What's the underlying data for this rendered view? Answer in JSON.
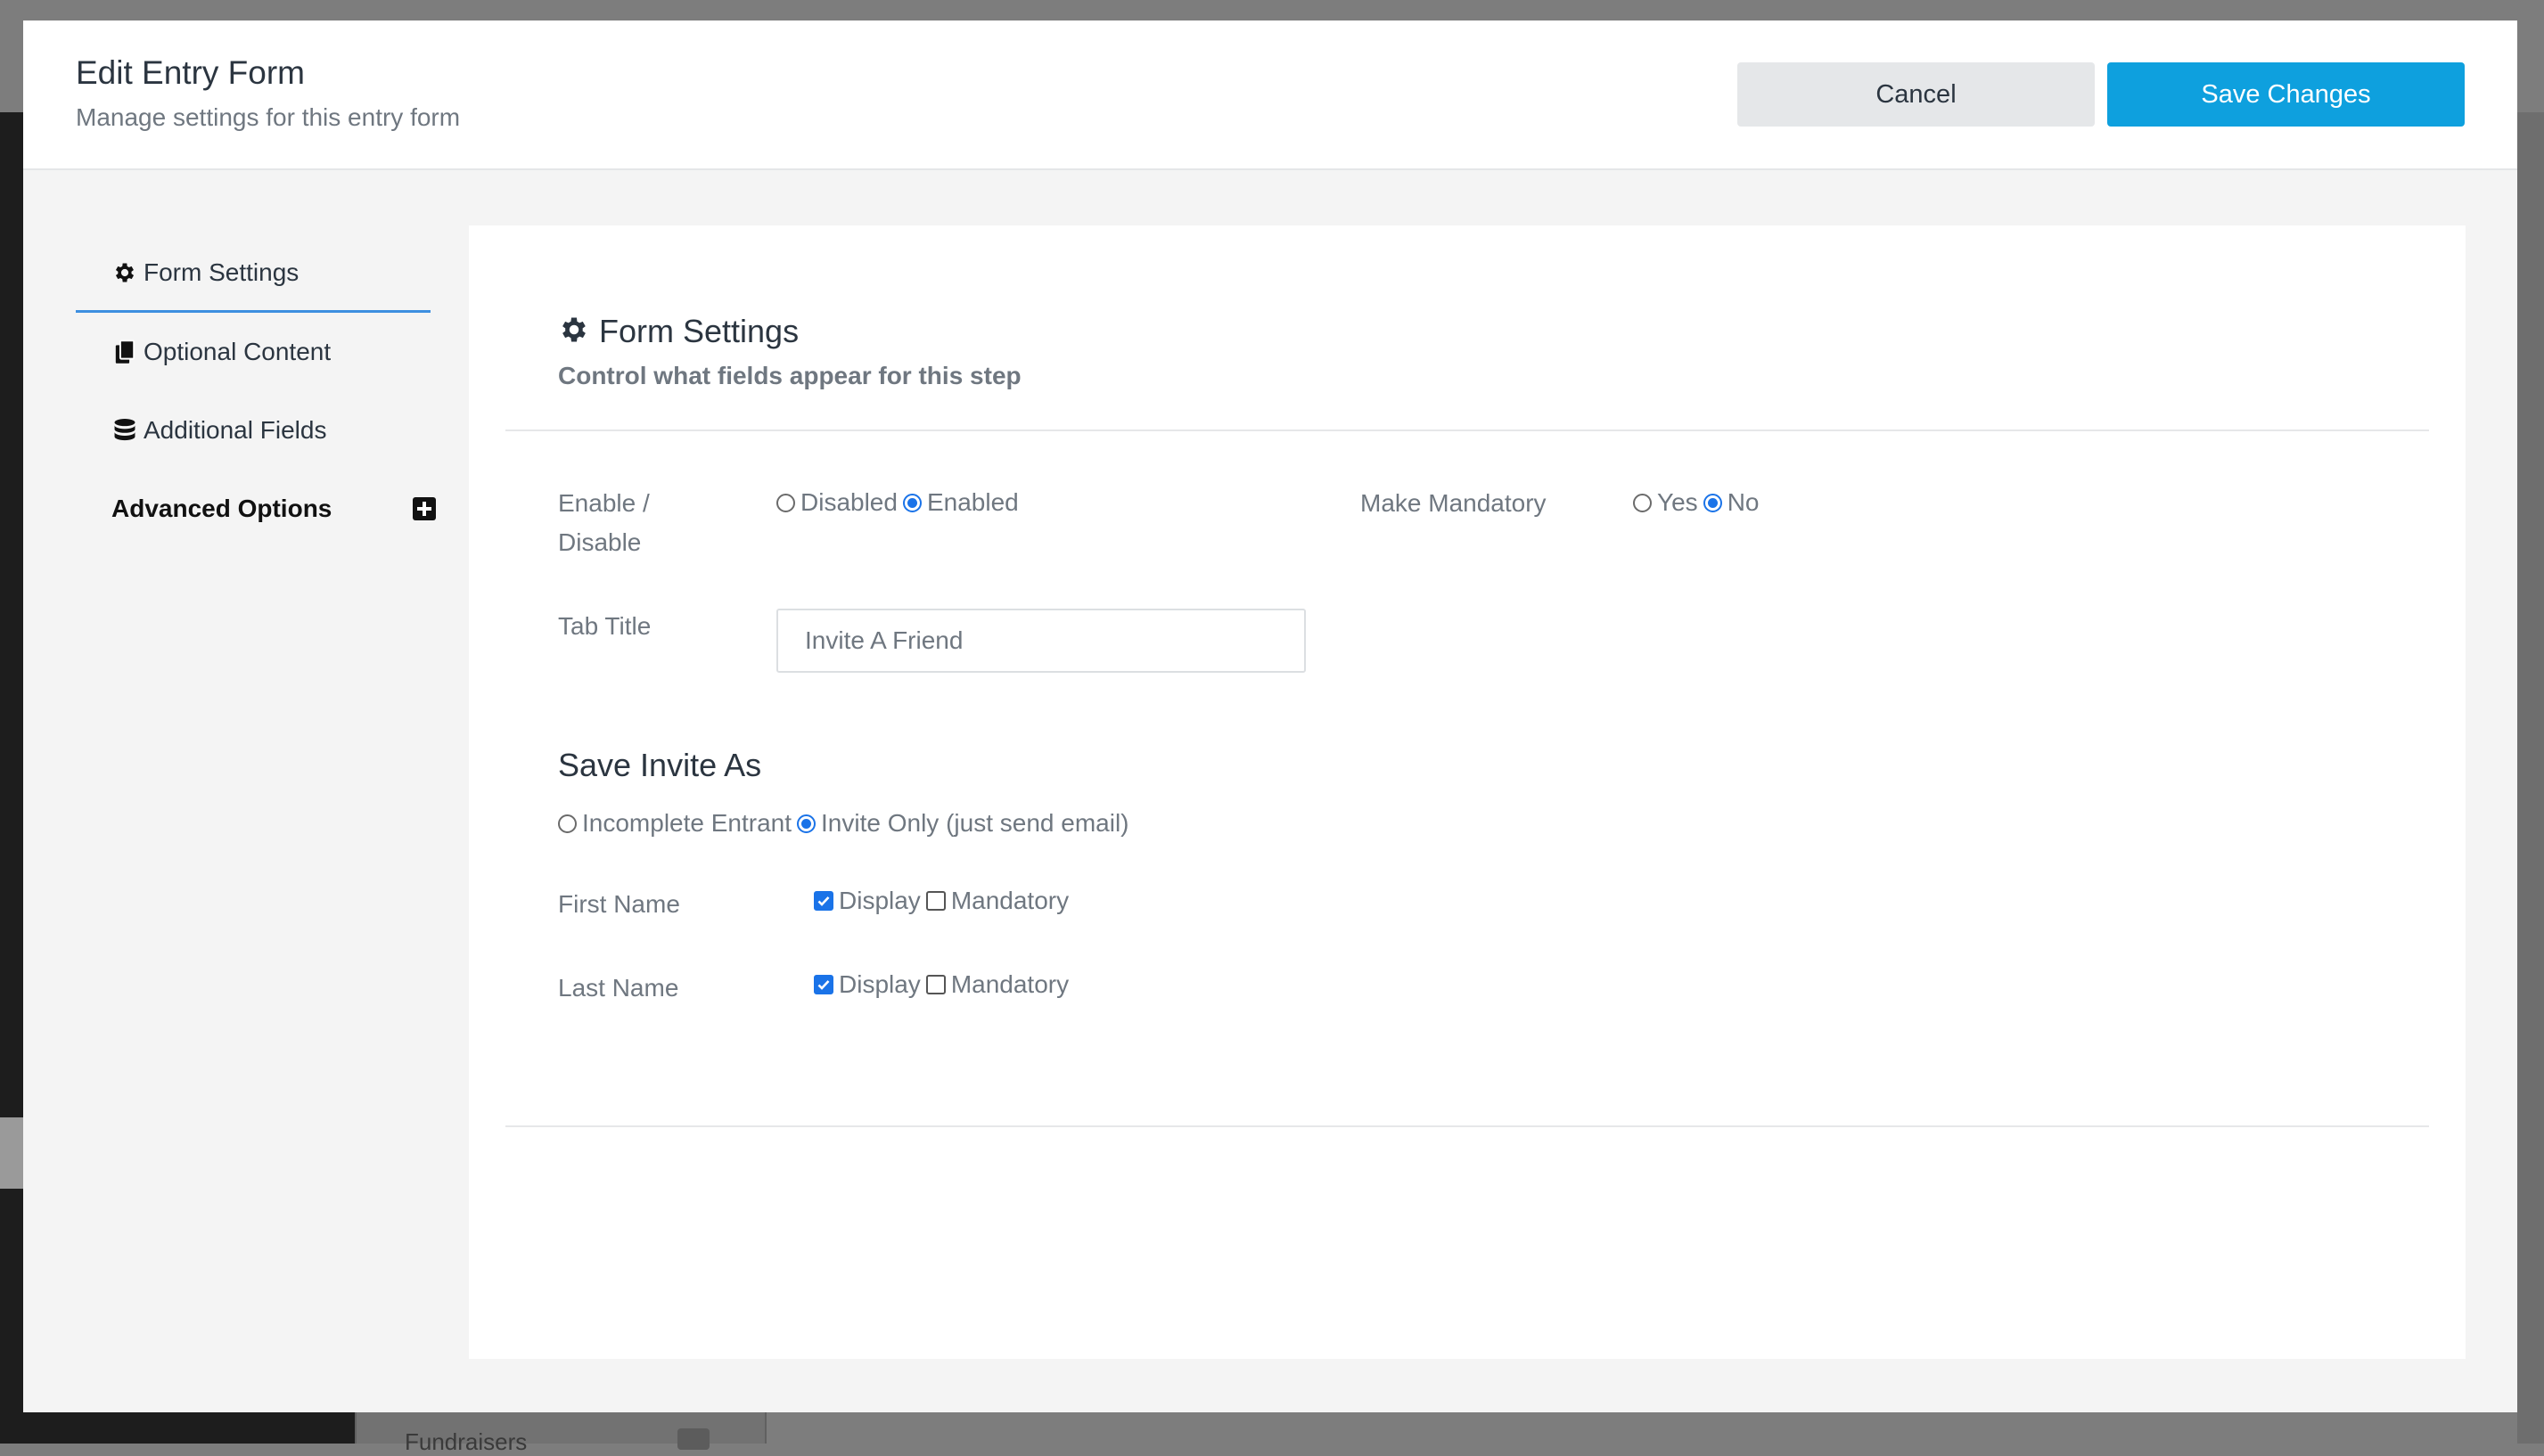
{
  "background": {
    "bottom_item": "Fundraisers"
  },
  "header": {
    "title": "Edit Entry Form",
    "subtitle": "Manage settings for this entry form",
    "cancel_label": "Cancel",
    "save_label": "Save Changes"
  },
  "nav": {
    "items": [
      {
        "label": "Form Settings",
        "icon": "gear-icon",
        "active": true
      },
      {
        "label": "Optional Content",
        "icon": "copy-icon"
      },
      {
        "label": "Additional Fields",
        "icon": "database-icon"
      },
      {
        "label": "Advanced Options",
        "icon": "plus-square-icon"
      }
    ]
  },
  "panel": {
    "title": "Form Settings",
    "subtitle": "Control what fields appear for this step",
    "enable": {
      "label_line1": "Enable /",
      "label_line2": "Disable",
      "options": [
        "Disabled",
        "Enabled"
      ],
      "selected": "Enabled"
    },
    "mandatory": {
      "label": "Make Mandatory",
      "options": [
        "Yes",
        "No"
      ],
      "selected": "No"
    },
    "tab_title": {
      "label": "Tab Title",
      "value": "Invite A Friend"
    },
    "save_invite": {
      "heading": "Save Invite As",
      "options": [
        "Incomplete Entrant",
        "Invite Only (just send email)"
      ],
      "selected": "Invite Only (just send email)"
    },
    "fields": [
      {
        "label": "First Name",
        "display_label": "Display",
        "display": true,
        "mandatory_label": "Mandatory",
        "mandatory": false
      },
      {
        "label": "Last Name",
        "display_label": "Display",
        "display": true,
        "mandatory_label": "Mandatory",
        "mandatory": false
      }
    ]
  },
  "colors": {
    "accent": "#0ea0de",
    "link_blue": "#1a73e8",
    "nav_underline": "#3d8fe0"
  }
}
